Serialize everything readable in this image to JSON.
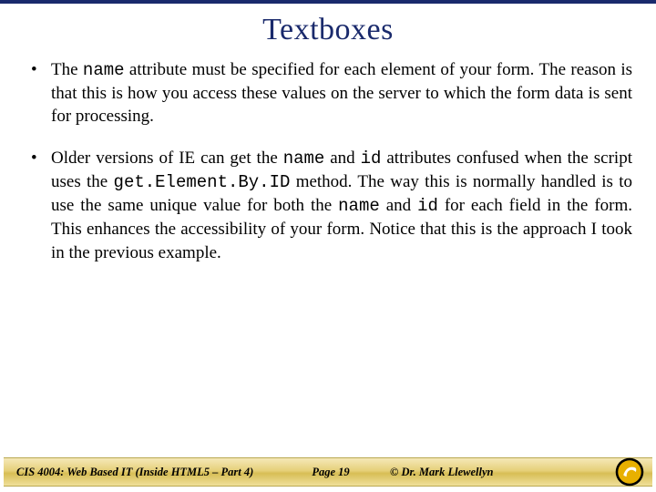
{
  "title": "Textboxes",
  "bullets": [
    {
      "prefix": "The ",
      "code1": "name",
      "mid1": " attribute must be specified for each element of your form. The reason is that this is how you access these values on the server to which the form data is sent for processing.",
      "code2": "",
      "mid2": "",
      "code3": "",
      "mid3": "",
      "code4": "",
      "mid4": "",
      "code5": "",
      "tail": ""
    },
    {
      "prefix": "Older versions of IE can get the ",
      "code1": "name",
      "mid1": " and ",
      "code2": "id",
      "mid2": " attributes confused when the script uses the ",
      "code3": "get.Element.By.ID",
      "mid3": " method.  The way this is normally handled is to use the same unique value for both the ",
      "code4": "name",
      "mid4": " and ",
      "code5": "id",
      "tail": " for each field in the form.  This enhances the accessibility of your form.  Notice that this is the approach I took in the previous example."
    }
  ],
  "footer": {
    "course": "CIS 4004: Web Based IT (Inside HTML5 – Part 4)",
    "page": "Page 19",
    "author": "© Dr. Mark Llewellyn"
  },
  "colors": {
    "accent": "#1a2a6c",
    "gold1": "#f5e8b8",
    "gold2": "#d7be55"
  }
}
